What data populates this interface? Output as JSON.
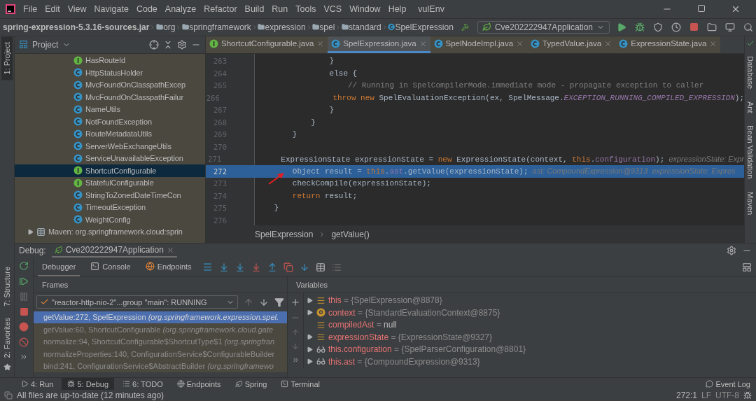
{
  "menu": [
    "File",
    "Edit",
    "View",
    "Navigate",
    "Code",
    "Analyze",
    "Refactor",
    "Build",
    "Run",
    "Tools",
    "VCS",
    "Window",
    "Help"
  ],
  "window": {
    "title": "vulEnv"
  },
  "breadcrumb": [
    {
      "label": "spring-expression-5.3.16-sources.jar",
      "kind": "jar"
    },
    {
      "label": "org",
      "kind": "folder"
    },
    {
      "label": "springframework",
      "kind": "folder"
    },
    {
      "label": "expression",
      "kind": "folder"
    },
    {
      "label": "spel",
      "kind": "folder"
    },
    {
      "label": "standard",
      "kind": "folder"
    },
    {
      "label": "SpelExpression",
      "kind": "class"
    }
  ],
  "run_config": "Cve202222947Application",
  "left_tabs": [
    {
      "label": "1: Project",
      "selected": true
    }
  ],
  "left_tabs_bottom": [
    {
      "label": "7: Structure",
      "selected": false
    },
    {
      "label": "2: Favorites",
      "selected": false
    }
  ],
  "right_tabs": [
    "Database",
    "Ant",
    "Bean Validation",
    "Maven"
  ],
  "project": {
    "title": "Project",
    "items": [
      {
        "label": "HasRouteId",
        "kind": "interface",
        "selected": false
      },
      {
        "label": "HttpStatusHolder",
        "kind": "class",
        "selected": false
      },
      {
        "label": "MvcFoundOnClasspathExcep",
        "kind": "class",
        "selected": false
      },
      {
        "label": "MvcFoundOnClasspathFailur",
        "kind": "class",
        "selected": false
      },
      {
        "label": "NameUtils",
        "kind": "class",
        "selected": false
      },
      {
        "label": "NotFoundException",
        "kind": "class",
        "selected": false
      },
      {
        "label": "RouteMetadataUtils",
        "kind": "class",
        "selected": false
      },
      {
        "label": "ServerWebExchangeUtils",
        "kind": "class",
        "selected": false
      },
      {
        "label": "ServiceUnavailableException",
        "kind": "class",
        "selected": false
      },
      {
        "label": "ShortcutConfigurable",
        "kind": "interface",
        "selected": true
      },
      {
        "label": "StatefulConfigurable",
        "kind": "interface",
        "selected": false
      },
      {
        "label": "StringToZonedDateTimeCon",
        "kind": "class",
        "selected": false
      },
      {
        "label": "TimeoutException",
        "kind": "class",
        "selected": false
      },
      {
        "label": "WeightConfig",
        "kind": "class",
        "selected": false
      }
    ],
    "libraries": [
      {
        "label": "Maven: org.springframework.cloud:sprin"
      }
    ]
  },
  "editor_tabs": [
    {
      "label": "ShortcutConfigurable.java",
      "kind": "interface",
      "selected": false
    },
    {
      "label": "SpelExpression.java",
      "kind": "class",
      "selected": true
    },
    {
      "label": "SpelNodeImpl.java",
      "kind": "class",
      "selected": false
    },
    {
      "label": "TypedValue.java",
      "kind": "class",
      "selected": false
    },
    {
      "label": "ExpressionState.java",
      "kind": "class",
      "selected": false
    }
  ],
  "code": [
    {
      "n": "263",
      "current": false,
      "tokens": [
        {
          "t": "                }",
          "kind": "plain"
        }
      ]
    },
    {
      "n": "264",
      "current": false,
      "tokens": [
        {
          "t": "                else {",
          "kind": "plain"
        }
      ]
    },
    {
      "n": "265",
      "current": false,
      "tokens": [
        {
          "t": "                    // Running in SpelCompilerMode.immediate mode - propagate exception to caller",
          "kind": "comment"
        }
      ]
    },
    {
      "n": "266",
      "current": false,
      "tokens": [
        {
          "t": "                    throw new",
          "kind": "kw"
        },
        {
          "t": " SpelEvaluationException(ex, SpelMessage.",
          "kind": "plain"
        },
        {
          "t": "EXCEPTION_RUNNING_COMPILED_EXPRESSION",
          "kind": "const"
        },
        {
          "t": ");",
          "kind": "plain"
        }
      ]
    },
    {
      "n": "267",
      "current": false,
      "tokens": [
        {
          "t": "                }",
          "kind": "plain"
        }
      ]
    },
    {
      "n": "268",
      "current": false,
      "tokens": [
        {
          "t": "            }",
          "kind": "plain"
        }
      ]
    },
    {
      "n": "269",
      "current": false,
      "tokens": [
        {
          "t": "        }",
          "kind": "plain"
        }
      ]
    },
    {
      "n": "270",
      "current": false
    },
    {
      "n": "271",
      "current": false,
      "tokens": [
        {
          "t": "        ExpressionState expressionState = ",
          "kind": "plain"
        },
        {
          "t": "new",
          "kind": "kw"
        },
        {
          "t": " ExpressionState(context, ",
          "kind": "plain"
        },
        {
          "t": "this",
          "kind": "kw"
        },
        {
          "t": ".",
          "kind": "plain"
        },
        {
          "t": "configuration",
          "kind": "field"
        },
        {
          "t": ");",
          "kind": "plain"
        },
        {
          "t": "  expressionState: Expr",
          "kind": "hint"
        }
      ]
    },
    {
      "n": "272",
      "current": true,
      "tokens": [
        {
          "t": "        Object result = ",
          "kind": "plain"
        },
        {
          "t": "this",
          "kind": "kw"
        },
        {
          "t": ".",
          "kind": "plain"
        },
        {
          "t": "ast",
          "kind": "field"
        },
        {
          "t": ".getValue(expressionState);",
          "kind": "plain"
        },
        {
          "t": "  ast: CompoundExpression@9313  expressionState: Expres",
          "kind": "hint"
        }
      ]
    },
    {
      "n": "273",
      "current": false,
      "tokens": [
        {
          "t": "        checkCompile(expressionState);",
          "kind": "plain"
        }
      ]
    },
    {
      "n": "274",
      "current": false,
      "tokens": [
        {
          "t": "        return",
          "kind": "kw"
        },
        {
          "t": " result;",
          "kind": "plain"
        }
      ]
    },
    {
      "n": "275",
      "current": false,
      "tokens": [
        {
          "t": "    }",
          "kind": "plain"
        }
      ]
    },
    {
      "n": "276",
      "current": false
    }
  ],
  "editor_breadcrumb": [
    "SpelExpression",
    "getValue()"
  ],
  "debug": {
    "label": "Debug:",
    "session": "Cve202222947Application",
    "tabs": [
      {
        "label": "Debugger",
        "kind": "debugger",
        "selected": true
      },
      {
        "label": "Console",
        "kind": "console",
        "selected": false
      },
      {
        "label": "Endpoints",
        "kind": "endpoints",
        "selected": false
      }
    ],
    "frames_title": "Frames",
    "thread": "\"reactor-http-nio-2\"...group \"main\": RUNNING",
    "frames": [
      {
        "text": "getValue:272, SpelExpression *(org.springframework.expression.spel.*",
        "selected": true
      },
      {
        "text": "getValue:60, ShortcutConfigurable *(org.springframework.cloud.gate*",
        "selected": false
      },
      {
        "text": "normalize:94, ShortcutConfigurable$ShortcutType$1 *(org.springfran*",
        "selected": false
      },
      {
        "text": "normalizeProperties:140, ConfigurationService$ConfigurableBuilder",
        "selected": false
      },
      {
        "text": "bind:241, ConfigurationService$AbstractBuilder *(org.springframewo*",
        "selected": false
      }
    ],
    "variables_title": "Variables",
    "variables": [
      {
        "name": "this",
        "sign": "=",
        "value": "{SpelExpression@8878}",
        "kind": "field",
        "expandable": true
      },
      {
        "name": "context",
        "sign": "=",
        "value": "{StandardEvaluationContext@8875}",
        "kind": "param",
        "expandable": true
      },
      {
        "name": "compiledAst",
        "sign": "=",
        "value": "null",
        "kind": "field",
        "expandable": false
      },
      {
        "name": "expressionState",
        "sign": "=",
        "value": "{ExpressionState@9327}",
        "kind": "field",
        "expandable": true
      },
      {
        "name": "this.configuration",
        "sign": "=",
        "value": "{SpelParserConfiguration@8801}",
        "kind": "watch",
        "expandable": true
      },
      {
        "name": "this.ast",
        "sign": "=",
        "value": "{CompoundExpression@9313}",
        "kind": "watch",
        "expandable": true
      }
    ]
  },
  "tool_buttons": [
    {
      "label": "4: Run",
      "kind": "run",
      "selected": false
    },
    {
      "label": "5: Debug",
      "kind": "debug",
      "selected": true
    },
    {
      "label": "6: TODO",
      "kind": "todo",
      "selected": false
    },
    {
      "label": "Endpoints",
      "kind": "endpoints",
      "selected": false
    },
    {
      "label": "Spring",
      "kind": "spring",
      "selected": false
    },
    {
      "label": "Terminal",
      "kind": "terminal",
      "selected": false
    }
  ],
  "event_log": "Event Log",
  "status": {
    "message": "All files are up-to-date (12 minutes ago)",
    "position": "272:1",
    "line_sep": "LF",
    "encoding": "UTF-8"
  }
}
